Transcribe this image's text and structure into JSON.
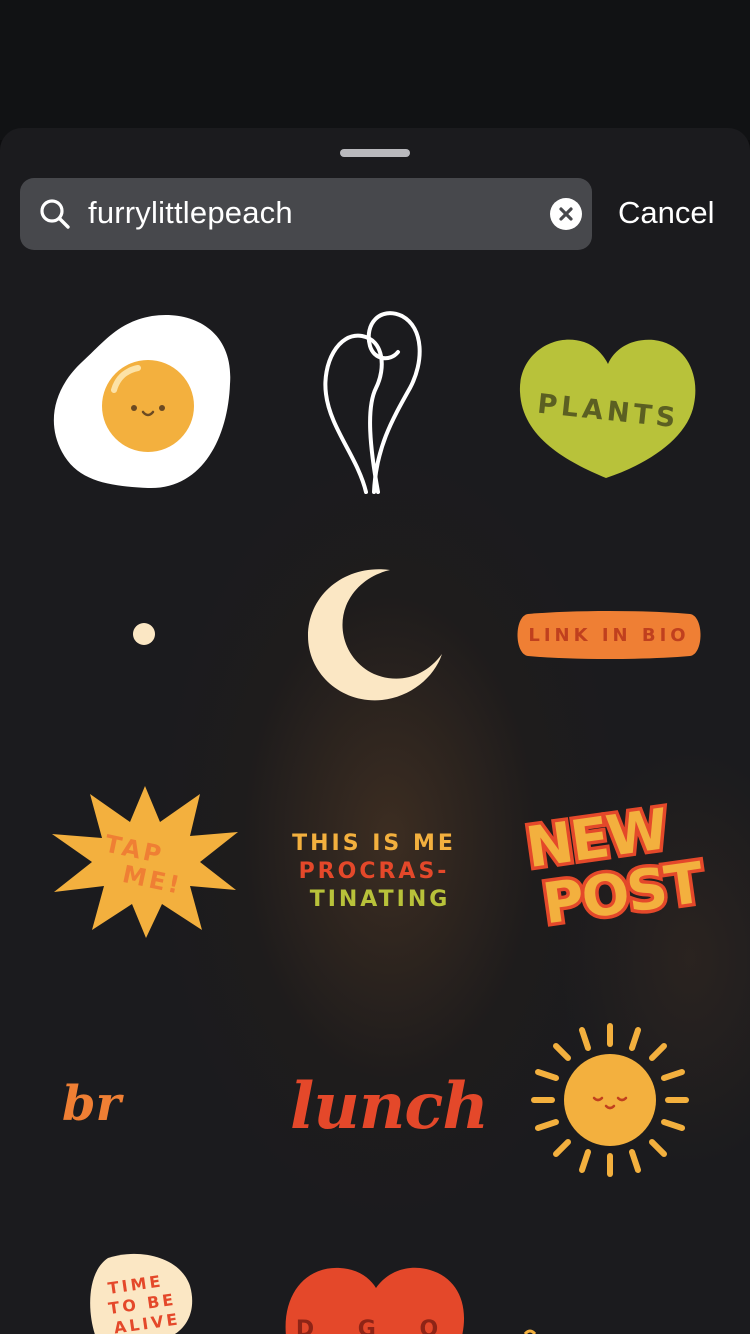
{
  "search": {
    "query": "furrylittlepeach",
    "cancel_label": "Cancel"
  },
  "stickers": {
    "plants": "PLANTS",
    "link_in_bio": "LINK IN BIO",
    "tap_me_line1": "TAP",
    "tap_me_line2": "ME!",
    "procrastinating_line1": "THIS IS ME",
    "procrastinating_line2": "PROCRAS-",
    "procrastinating_line3": "TINATING",
    "new_post_line1": "NEW",
    "new_post_line2": "POST",
    "brb": "br",
    "lunch": "lunch",
    "time_to_be_alive_line1": "TIME",
    "time_to_be_alive_line2": "TO BE",
    "time_to_be_alive_line3": "ALIVE",
    "heart_partial": "D G O"
  },
  "colors": {
    "sheet": "#1b1b1e",
    "search_field": "#47484c",
    "orange": "#ef7f34",
    "yellow": "#f3b03e",
    "lime": "#b8c23a",
    "red": "#e4482a",
    "cream": "#fbe7c4"
  }
}
